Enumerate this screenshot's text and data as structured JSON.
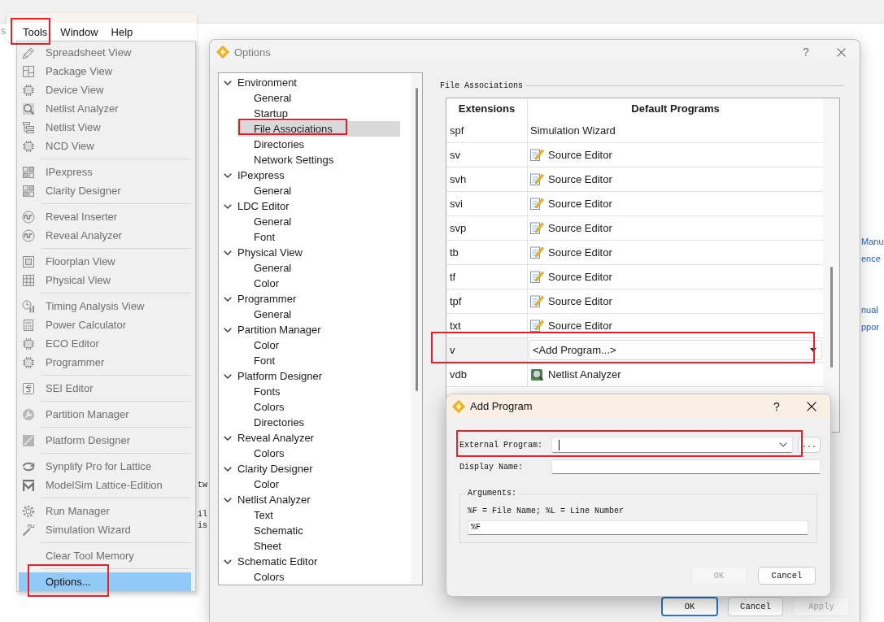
{
  "background_app": {
    "fragment": "s",
    "left_pane_lines": [
      "tw",
      "il",
      "is"
    ],
    "right_pane_links": [
      "Manu",
      "ence",
      "nual",
      "ppor"
    ]
  },
  "tools_menu": {
    "menubar": [
      {
        "label": "Tools",
        "callout": true
      },
      {
        "label": "Window",
        "callout": false
      },
      {
        "label": "Help",
        "callout": false
      }
    ],
    "groups": [
      {
        "items": [
          {
            "label": "Spreadsheet View",
            "disabled": true,
            "selected": false,
            "callout": false
          },
          {
            "label": "Package View",
            "disabled": true,
            "selected": false,
            "callout": false
          },
          {
            "label": "Device View",
            "disabled": true,
            "selected": false,
            "callout": false
          },
          {
            "label": "Netlist Analyzer",
            "disabled": true,
            "selected": false,
            "callout": false
          },
          {
            "label": "Netlist View",
            "disabled": true,
            "selected": false,
            "callout": false
          },
          {
            "label": "NCD View",
            "disabled": true,
            "selected": false,
            "callout": false
          }
        ]
      },
      {
        "items": [
          {
            "label": "IPexpress",
            "disabled": true,
            "selected": false,
            "callout": false
          },
          {
            "label": "Clarity Designer",
            "disabled": true,
            "selected": false,
            "callout": false
          }
        ]
      },
      {
        "items": [
          {
            "label": "Reveal Inserter",
            "disabled": true,
            "selected": false,
            "callout": false
          },
          {
            "label": "Reveal Analyzer",
            "disabled": true,
            "selected": false,
            "callout": false
          }
        ]
      },
      {
        "items": [
          {
            "label": "Floorplan View",
            "disabled": true,
            "selected": false,
            "callout": false
          },
          {
            "label": "Physical View",
            "disabled": true,
            "selected": false,
            "callout": false
          }
        ]
      },
      {
        "items": [
          {
            "label": "Timing Analysis View",
            "disabled": true,
            "selected": false,
            "callout": false
          },
          {
            "label": "Power Calculator",
            "disabled": true,
            "selected": false,
            "callout": false
          },
          {
            "label": "ECO Editor",
            "disabled": true,
            "selected": false,
            "callout": false
          },
          {
            "label": "Programmer",
            "disabled": true,
            "selected": false,
            "callout": false
          }
        ]
      },
      {
        "items": [
          {
            "label": "SEI Editor",
            "disabled": true,
            "selected": false,
            "callout": false
          }
        ]
      },
      {
        "items": [
          {
            "label": "Partition Manager",
            "disabled": true,
            "selected": false,
            "callout": false
          }
        ]
      },
      {
        "items": [
          {
            "label": "Platform Designer",
            "disabled": true,
            "selected": false,
            "callout": false
          }
        ]
      },
      {
        "items": [
          {
            "label": "Synplify Pro for Lattice",
            "disabled": true,
            "selected": false,
            "callout": false
          },
          {
            "label": "ModelSim Lattice-Edition",
            "disabled": true,
            "selected": false,
            "callout": false
          }
        ]
      },
      {
        "items": [
          {
            "label": "Run Manager",
            "disabled": true,
            "selected": false,
            "callout": false
          },
          {
            "label": "Simulation Wizard",
            "disabled": true,
            "selected": false,
            "callout": false
          }
        ]
      },
      {
        "items": [
          {
            "label": "Clear Tool Memory",
            "disabled": true,
            "selected": false,
            "callout": false
          }
        ]
      },
      {
        "items": [
          {
            "label": "Options...",
            "disabled": false,
            "selected": true,
            "callout": true
          }
        ]
      }
    ]
  },
  "options_dialog": {
    "title": "Options",
    "help": "?",
    "tree": [
      {
        "label": "Environment",
        "expanded": true,
        "selected": false,
        "children": [
          {
            "label": "General",
            "selected": false,
            "callout": false
          },
          {
            "label": "Startup",
            "selected": false,
            "callout": false
          },
          {
            "label": "File Associations",
            "selected": true,
            "callout": true
          },
          {
            "label": "Directories",
            "selected": false,
            "callout": false
          },
          {
            "label": "Network Settings",
            "selected": false,
            "callout": false
          }
        ]
      },
      {
        "label": "IPexpress",
        "expanded": true,
        "selected": false,
        "children": [
          {
            "label": "General",
            "selected": false,
            "callout": false
          }
        ]
      },
      {
        "label": "LDC Editor",
        "expanded": true,
        "selected": false,
        "children": [
          {
            "label": "General",
            "selected": false,
            "callout": false
          },
          {
            "label": "Font",
            "selected": false,
            "callout": false
          }
        ]
      },
      {
        "label": "Physical View",
        "expanded": true,
        "selected": false,
        "children": [
          {
            "label": "General",
            "selected": false,
            "callout": false
          },
          {
            "label": "Color",
            "selected": false,
            "callout": false
          }
        ]
      },
      {
        "label": "Programmer",
        "expanded": true,
        "selected": false,
        "children": [
          {
            "label": "General",
            "selected": false,
            "callout": false
          }
        ]
      },
      {
        "label": "Partition Manager",
        "expanded": true,
        "selected": false,
        "children": [
          {
            "label": "Color",
            "selected": false,
            "callout": false
          },
          {
            "label": "Font",
            "selected": false,
            "callout": false
          }
        ]
      },
      {
        "label": "Platform Designer",
        "expanded": true,
        "selected": false,
        "children": [
          {
            "label": "Fonts",
            "selected": false,
            "callout": false
          },
          {
            "label": "Colors",
            "selected": false,
            "callout": false
          },
          {
            "label": "Directories",
            "selected": false,
            "callout": false
          }
        ]
      },
      {
        "label": "Reveal Analyzer",
        "expanded": true,
        "selected": false,
        "children": [
          {
            "label": "Colors",
            "selected": false,
            "callout": false
          }
        ]
      },
      {
        "label": "Clarity Designer",
        "expanded": true,
        "selected": false,
        "children": [
          {
            "label": "Color",
            "selected": false,
            "callout": false
          }
        ]
      },
      {
        "label": "Netlist Analyzer",
        "expanded": true,
        "selected": false,
        "children": [
          {
            "label": "Text",
            "selected": false,
            "callout": false
          },
          {
            "label": "Schematic",
            "selected": false,
            "callout": false
          },
          {
            "label": "Sheet",
            "selected": false,
            "callout": false
          }
        ]
      },
      {
        "label": "Schematic Editor",
        "expanded": true,
        "selected": false,
        "children": [
          {
            "label": "Colors",
            "selected": false,
            "callout": false
          }
        ]
      }
    ],
    "section_title": "File Associations",
    "table": {
      "columns": [
        "Extensions",
        "Default Programs"
      ],
      "rows": [
        {
          "extension": "spf",
          "program": "Simulation Wizard",
          "kind": "plain",
          "selected": false,
          "callout": false
        },
        {
          "extension": "sv",
          "program": "Source Editor",
          "kind": "editor",
          "selected": false,
          "callout": false
        },
        {
          "extension": "svh",
          "program": "Source Editor",
          "kind": "editor",
          "selected": false,
          "callout": false
        },
        {
          "extension": "svi",
          "program": "Source Editor",
          "kind": "editor",
          "selected": false,
          "callout": false
        },
        {
          "extension": "svp",
          "program": "Source Editor",
          "kind": "editor",
          "selected": false,
          "callout": false
        },
        {
          "extension": "tb",
          "program": "Source Editor",
          "kind": "editor",
          "selected": false,
          "callout": false
        },
        {
          "extension": "tf",
          "program": "Source Editor",
          "kind": "editor",
          "selected": false,
          "callout": false
        },
        {
          "extension": "tpf",
          "program": "Source Editor",
          "kind": "editor",
          "selected": false,
          "callout": false
        },
        {
          "extension": "txt",
          "program": "Source Editor",
          "kind": "editor",
          "selected": false,
          "callout": false
        },
        {
          "extension": "v",
          "program": "<Add Program...>",
          "kind": "combo",
          "selected": true,
          "callout": true
        },
        {
          "extension": "vdb",
          "program": "Netlist Analyzer",
          "kind": "analyzer",
          "selected": false,
          "callout": false
        }
      ]
    },
    "buttons": [
      {
        "label": "OK",
        "default": true,
        "disabled": false
      },
      {
        "label": "Cancel",
        "default": false,
        "disabled": false
      },
      {
        "label": "Apply",
        "default": false,
        "disabled": true
      }
    ]
  },
  "add_program_dialog": {
    "title": "Add Program",
    "help": "?",
    "fields": [
      {
        "label": "External Program:",
        "kind": "combo",
        "focused": true,
        "callout": true,
        "browse": "..."
      },
      {
        "label": "Display Name:",
        "kind": "text",
        "focused": false,
        "callout": false
      }
    ],
    "arguments": {
      "title": "Arguments:",
      "hint": "%F = File Name; %L = Line Number",
      "value": "%F"
    },
    "buttons": [
      {
        "label": "OK",
        "disabled": true
      },
      {
        "label": "Cancel",
        "disabled": false
      }
    ]
  }
}
